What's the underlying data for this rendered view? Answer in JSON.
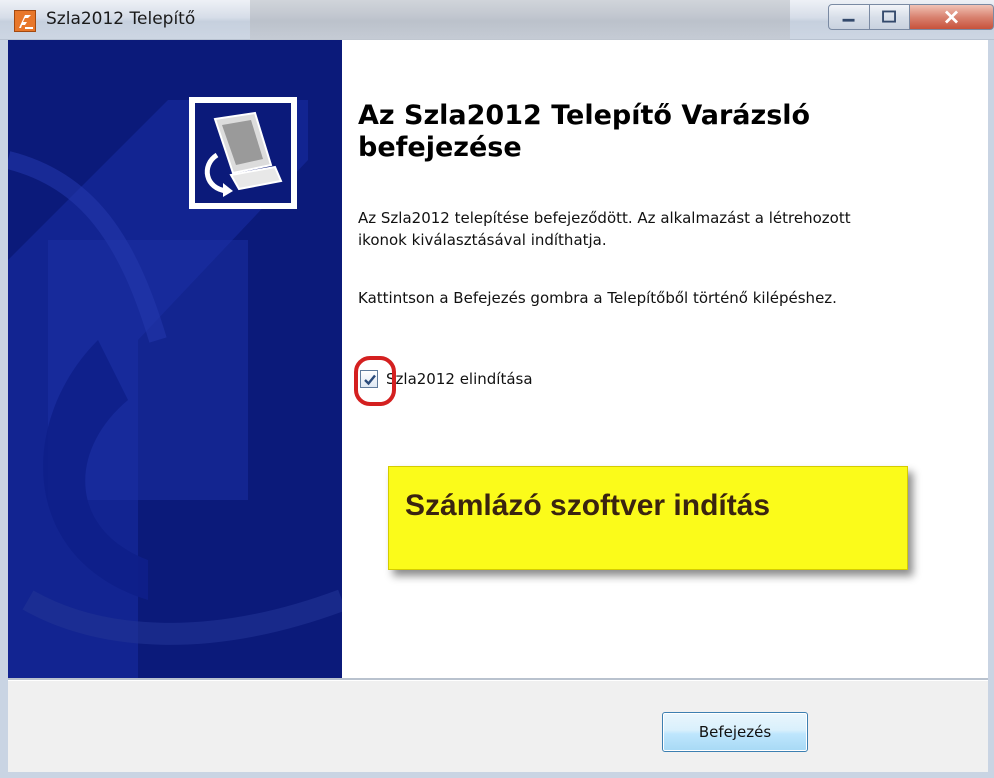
{
  "window": {
    "title": "Szla2012 Telepítő",
    "app_icon": "installer-app-icon",
    "controls": [
      "minimize-icon",
      "maximize-icon",
      "close-icon"
    ]
  },
  "side_panel": {
    "logo_icon": "computer-install-icon",
    "background_color": "#0b1a7a"
  },
  "main": {
    "heading": "Az Szla2012 Telepítő Varázsló befejezése",
    "paragraph1": "Az Szla2012 telepítése befejeződött. Az alkalmazást a létrehozott ikonok kiválasztásával indíthatja.",
    "paragraph2": "Kattintson a Befejezés gombra a Telepítőből történő kilépéshez.",
    "checkbox": {
      "label": "Szla2012 elindítása",
      "checked": true
    }
  },
  "annotation": {
    "callout_text": "Számlázó szoftver indítás",
    "callout_color": "#fbfb1a",
    "highlight_color": "#d42020"
  },
  "footer": {
    "finish_label": "Befejezés"
  }
}
